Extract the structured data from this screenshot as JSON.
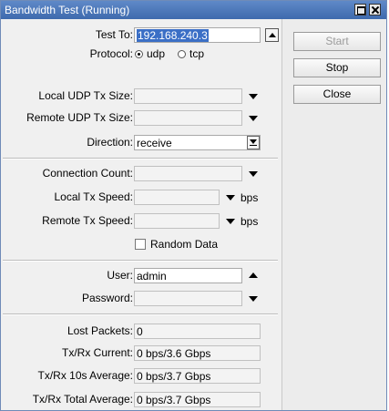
{
  "window": {
    "title": "Bandwidth Test (Running)"
  },
  "form": {
    "test_to_label": "Test To:",
    "test_to_value": "192.168.240.3",
    "protocol_label": "Protocol:",
    "protocol_options": [
      "udp",
      "tcp"
    ],
    "protocol_selected": "udp",
    "local_udp_label": "Local UDP Tx Size:",
    "remote_udp_label": "Remote UDP Tx Size:",
    "direction_label": "Direction:",
    "direction_value": "receive",
    "connection_count_label": "Connection Count:",
    "local_tx_label": "Local Tx Speed:",
    "remote_tx_label": "Remote Tx Speed:",
    "bps_unit": "bps",
    "random_data_label": "Random Data",
    "user_label": "User:",
    "user_value": "admin",
    "password_label": "Password:",
    "lost_packets_label": "Lost Packets:",
    "lost_packets_value": "0",
    "current_label": "Tx/Rx Current:",
    "current_value": "0 bps/3.6 Gbps",
    "avg10_label": "Tx/Rx 10s Average:",
    "avg10_value": "0 bps/3.7 Gbps",
    "total_label": "Tx/Rx Total Average:",
    "total_value": "0 bps/3.7 Gbps"
  },
  "buttons": {
    "start": "Start",
    "stop": "Stop",
    "close": "Close"
  }
}
